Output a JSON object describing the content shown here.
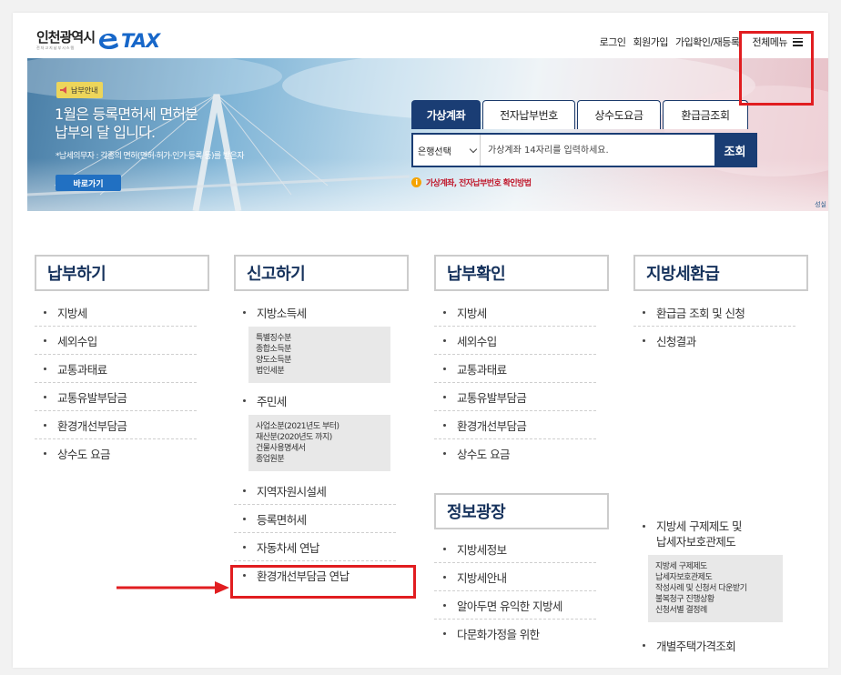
{
  "header": {
    "logo_city": "인천광역시",
    "logo_sub": "전자고지납부시스템",
    "logo_tax": "TAX",
    "nav": [
      "로그인",
      "회원가입",
      "가입확인/재등록"
    ],
    "menu_all": "전체메뉴"
  },
  "banner": {
    "badge": "납부안내",
    "title_line1": "1월은 등록면허세 면허분",
    "title_line2": "납부의 달 입니다.",
    "desc": "*납세의무자 : 각종의 면허(면허·허가·인가·등록 등)를 받은자",
    "button": "바로가기",
    "side_label": "성실"
  },
  "search": {
    "tabs": [
      "가상계좌",
      "전자납부번호",
      "상수도요금",
      "환급금조회"
    ],
    "active_tab": "가상계좌",
    "bank_select": "은행선택",
    "placeholder": "가상계좌 14자리를 입력하세요.",
    "submit": "조회",
    "notice": "가상계좌, 전자납부번호 확인방법"
  },
  "columns": {
    "pay": {
      "title": "납부하기",
      "items": [
        "지방세",
        "세외수입",
        "교통과태료",
        "교통유발부담금",
        "환경개선부담금",
        "상수도 요금"
      ]
    },
    "report": {
      "title": "신고하기",
      "items": [
        {
          "label": "지방소득세",
          "sub": [
            "특별징수분",
            "종합소득분",
            "양도소득분",
            "법인세분"
          ]
        },
        {
          "label": "주민세",
          "sub": [
            "사업소분(2021년도 부터)",
            "재산분(2020년도 까지)",
            "건물사용명세서",
            "종업원분"
          ]
        },
        {
          "label": "지역자원시설세"
        },
        {
          "label": "등록면허세"
        },
        {
          "label": "자동차세 연납"
        },
        {
          "label": "환경개선부담금 연납"
        }
      ]
    },
    "confirm": {
      "title": "납부확인",
      "items": [
        "지방세",
        "세외수입",
        "교통과태료",
        "교통유발부담금",
        "환경개선부담금",
        "상수도 요금"
      ]
    },
    "info": {
      "title": "정보광장",
      "items": [
        "지방세정보",
        "지방세안내",
        "알아두면 유익한 지방세",
        "다문화가정을 위한"
      ]
    },
    "refund": {
      "title": "지방세환급",
      "items": [
        "환급금 조회 및 신청",
        "신청결과"
      ]
    },
    "relief": {
      "label_line1": "지방세 구제제도 및",
      "label_line2": "납세자보호관제도",
      "sub": [
        "지방세 구제제도",
        "납세자보호관제도",
        "작성사례 및 신청서 다운받기",
        "불복청구 진행상황",
        "신청서별 결정례"
      ],
      "last_item": "개별주택가격조회"
    }
  },
  "colors": {
    "navy": "#1a3d74",
    "title_navy": "#16325c",
    "highlight_red": "#e11d20",
    "logo_blue": "#1767c9"
  }
}
